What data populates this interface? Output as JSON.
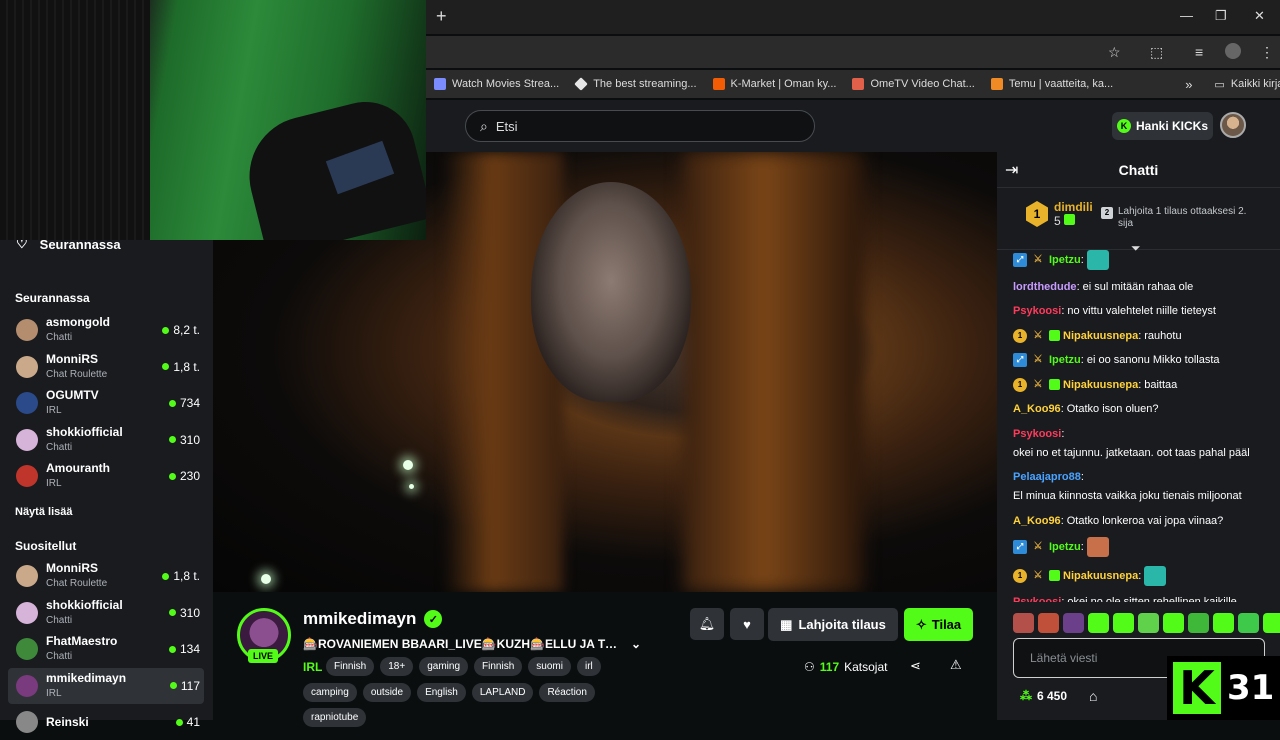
{
  "browser": {
    "new_tab": "+",
    "window_controls": [
      "—",
      "❐",
      "✕"
    ],
    "bookmarks": [
      {
        "label": "Watch Movies Strea...",
        "color": "#7b8cff"
      },
      {
        "label": "The best streaming...",
        "color": "#e6e6e6"
      },
      {
        "label": "K-Market | Oman ky...",
        "color": "#f25c05"
      },
      {
        "label": "OmeTV Video Chat...",
        "color": "#e0604a"
      },
      {
        "label": "Temu | vaatteita, ka...",
        "color": "#f08a24"
      }
    ],
    "bookmarks_more": "»",
    "all_bookmarks": "Kaikki kirjanmerkit"
  },
  "header": {
    "search_placeholder": "Etsi",
    "hanki_label": "Hanki KICKs"
  },
  "sidebar": {
    "following_header": "Seurannassa",
    "following_title": "Seurannassa",
    "following": [
      {
        "name": "asmongold",
        "category": "Chatti",
        "viewers": "8,2 t.",
        "color": "#b48c6e"
      },
      {
        "name": "MonniRS",
        "category": "Chat Roulette",
        "viewers": "1,8 t.",
        "color": "#c9a98a"
      },
      {
        "name": "OGUMTV",
        "category": "IRL",
        "viewers": "734",
        "color": "#2b4a8a"
      },
      {
        "name": "shokkiofficial",
        "category": "Chatti",
        "viewers": "310",
        "color": "#d6b3d8"
      },
      {
        "name": "Amouranth",
        "category": "IRL",
        "viewers": "230",
        "color": "#c0352b"
      }
    ],
    "show_more": "Näytä lisää",
    "recommended_title": "Suositellut",
    "recommended": [
      {
        "name": "MonniRS",
        "category": "Chat Roulette",
        "viewers": "1,8 t.",
        "color": "#c9a98a"
      },
      {
        "name": "shokkiofficial",
        "category": "Chatti",
        "viewers": "310",
        "color": "#d6b3d8"
      },
      {
        "name": "FhatMaestro",
        "category": "Chatti",
        "viewers": "134",
        "color": "#3e8a3a"
      },
      {
        "name": "mmikedimayn",
        "category": "IRL",
        "viewers": "117",
        "color": "#7a3a7e"
      },
      {
        "name": "Reinski",
        "category": "",
        "viewers": "41",
        "color": "#888888"
      }
    ]
  },
  "stream": {
    "live_label": "LIVE",
    "name": "mmikedimayn",
    "title": "🎰ROVANIEMEN BBAARI_LIVE🎰KUZH🎰ELLU JA TOV...",
    "category": "IRL",
    "tags_row1": [
      "Finnish",
      "18+",
      "gaming",
      "Finnish",
      "suomi",
      "irl"
    ],
    "tags_row2": [
      "camping",
      "outside",
      "English",
      "LAPLAND",
      "Réaction"
    ],
    "tags_row3": [
      "rapniotube"
    ],
    "gift_label": "Lahjoita tilaus",
    "subscribe_label": "Tilaa",
    "viewer_count": "117",
    "viewer_label": "Katsojat"
  },
  "chat": {
    "title": "Chatti",
    "leader_rank": "1",
    "leader_name": "dimdili",
    "leader_count": "5",
    "second_rank": "2",
    "second_text": "Lahjoita 1 tilaus ottaaksesi 2. sija",
    "messages": [
      {
        "user": "Ipetzu",
        "color": "#53fc18",
        "text": "",
        "badges": [
          "blue",
          "sword"
        ],
        "emote": "#2ab7a9"
      },
      {
        "user": "lordthedude",
        "color": "#c89bff",
        "text": "ei sul mitään rahaa ole",
        "badges": []
      },
      {
        "user": "Psykoosi",
        "color": "#ff3b5c",
        "text": "no vittu valehtelet niille tieteyst",
        "badges": []
      },
      {
        "user": "Nipakuusnepa",
        "color": "#ffd23b",
        "text": "rauhotu",
        "badges": [
          "gold1",
          "sword",
          "sub"
        ]
      },
      {
        "user": "Ipetzu",
        "color": "#53fc18",
        "text": "ei oo sanonu Mikko tollasta",
        "badges": [
          "blue",
          "sword"
        ]
      },
      {
        "user": "Nipakuusnepa",
        "color": "#ffd23b",
        "text": "baittaa",
        "badges": [
          "gold1",
          "sword",
          "sub"
        ]
      },
      {
        "user": "A_Koo96",
        "color": "#ffd23b",
        "text": "Otatko ison oluen?",
        "badges": []
      },
      {
        "user": "Psykoosi",
        "color": "#ff3b5c",
        "text": "okei no et tajunnu. jatketaan. oot taas pahal pääl",
        "badges": []
      },
      {
        "user": "Pelaajapro88",
        "color": "#4aa3ff",
        "text": "El minua kiinnosta vaikka joku tienais miljoonat",
        "badges": []
      },
      {
        "user": "A_Koo96",
        "color": "#ffd23b",
        "text": "Otatko lonkeroa vai jopa viinaa?",
        "badges": []
      },
      {
        "user": "Ipetzu",
        "color": "#53fc18",
        "text": "",
        "badges": [
          "blue",
          "sword"
        ],
        "emote": "#c8704a"
      },
      {
        "user": "Nipakuusnepa",
        "color": "#ffd23b",
        "text": "",
        "badges": [
          "gold1",
          "sword",
          "sub"
        ],
        "emote": "#2ab7a9"
      },
      {
        "user": "Psykoosi",
        "color": "#ff3b5c",
        "text": "okei no ole sitten rehellinen kaikille",
        "badges": []
      }
    ],
    "emote_colors": [
      "#b4504a",
      "#c0503a",
      "#6b3f8a",
      "#53fc18",
      "#53fc18",
      "#5fd14a",
      "#53fc18",
      "#3fb83a",
      "#53fc18",
      "#3fc94a",
      "#53fc18"
    ],
    "input_placeholder": "Lähetä viesti",
    "points": "6 450"
  },
  "overlay": {
    "k_logo": "K",
    "k_number": "31"
  }
}
